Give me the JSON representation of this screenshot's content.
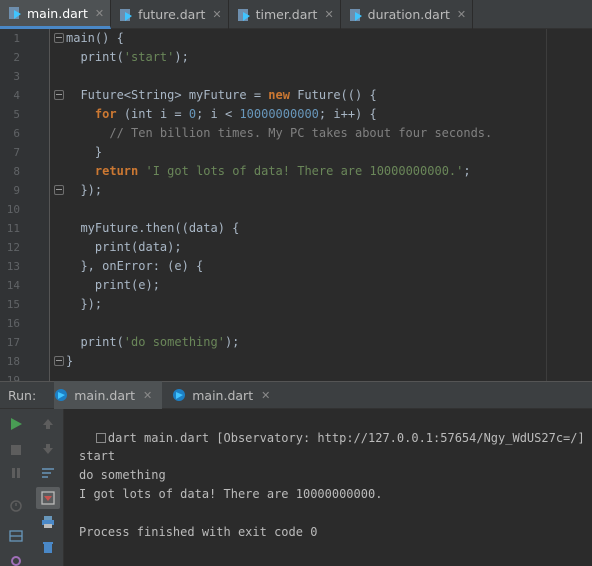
{
  "tabs": [
    {
      "label": "main.dart",
      "active": true
    },
    {
      "label": "future.dart",
      "active": false
    },
    {
      "label": "timer.dart",
      "active": false
    },
    {
      "label": "duration.dart",
      "active": false
    }
  ],
  "editor": {
    "line_numbers": [
      "1",
      "2",
      "3",
      "4",
      "5",
      "6",
      "7",
      "8",
      "9",
      "10",
      "11",
      "12",
      "13",
      "14",
      "15",
      "16",
      "17",
      "18",
      "19"
    ],
    "lines": [
      [
        {
          "t": "main() {",
          "c": "plain"
        }
      ],
      [
        {
          "t": "  print(",
          "c": "plain"
        },
        {
          "t": "'start'",
          "c": "str"
        },
        {
          "t": ");",
          "c": "plain"
        }
      ],
      [],
      [
        {
          "t": "  Future<String> myFuture = ",
          "c": "plain"
        },
        {
          "t": "new",
          "c": "kw"
        },
        {
          "t": " Future(() {",
          "c": "plain"
        }
      ],
      [
        {
          "t": "    ",
          "c": "plain"
        },
        {
          "t": "for",
          "c": "kw"
        },
        {
          "t": " (int i = ",
          "c": "plain"
        },
        {
          "t": "0",
          "c": "num"
        },
        {
          "t": "; i < ",
          "c": "plain"
        },
        {
          "t": "10000000000",
          "c": "num"
        },
        {
          "t": "; i++) {",
          "c": "plain"
        }
      ],
      [
        {
          "t": "      // Ten billion times. My PC takes about four seconds.",
          "c": "cmt"
        }
      ],
      [
        {
          "t": "    }",
          "c": "plain"
        }
      ],
      [
        {
          "t": "    ",
          "c": "plain"
        },
        {
          "t": "return",
          "c": "kw"
        },
        {
          "t": " ",
          "c": "plain"
        },
        {
          "t": "'I got lots of data! There are 10000000000.'",
          "c": "str"
        },
        {
          "t": ";",
          "c": "plain"
        }
      ],
      [
        {
          "t": "  });",
          "c": "plain"
        }
      ],
      [],
      [
        {
          "t": "  myFuture.then((data) {",
          "c": "plain"
        }
      ],
      [
        {
          "t": "    print(data);",
          "c": "plain"
        }
      ],
      [
        {
          "t": "  }, onError: (e) {",
          "c": "plain"
        }
      ],
      [
        {
          "t": "    print(e);",
          "c": "plain"
        }
      ],
      [
        {
          "t": "  });",
          "c": "plain"
        }
      ],
      [],
      [
        {
          "t": "  print(",
          "c": "plain"
        },
        {
          "t": "'do something'",
          "c": "str"
        },
        {
          "t": ");",
          "c": "plain"
        }
      ],
      [
        {
          "t": "}",
          "c": "plain"
        }
      ],
      []
    ]
  },
  "run": {
    "label": "Run:",
    "tabs": [
      {
        "label": "main.dart",
        "active": true
      },
      {
        "label": "main.dart",
        "active": false
      }
    ],
    "console": {
      "header": "dart main.dart [Observatory: http://127.0.0.1:57654/Ngy_WdUS27c=/]",
      "output": [
        "start",
        "do something",
        "I got lots of data! There are 10000000000.",
        "",
        "Process finished with exit code 0"
      ]
    }
  },
  "colors": {
    "accent": "#4a88c7",
    "run_green": "#499c54",
    "keyword": "#cc7832",
    "string": "#6a8759",
    "number": "#6897bb",
    "comment": "#808080"
  },
  "icons": {
    "file": "dart-file-icon",
    "run": "play-icon",
    "stop": "stop-icon",
    "pause": "pause-icon",
    "up": "arrow-up-icon",
    "down": "arrow-down-icon",
    "delete": "trash-icon",
    "print": "printer-icon"
  }
}
